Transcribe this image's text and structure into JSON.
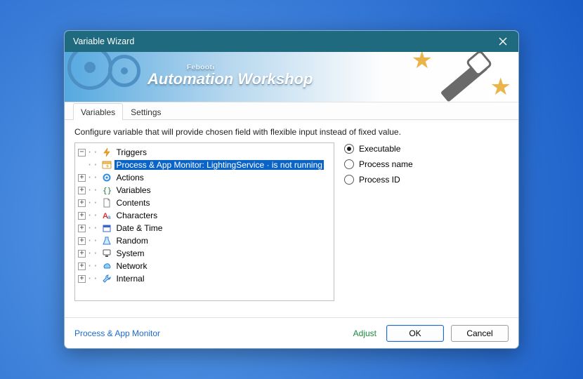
{
  "window": {
    "title": "Variable Wizard"
  },
  "banner": {
    "brand_small": "Febooti",
    "brand": "Automation Workshop"
  },
  "tabs": {
    "variables": "Variables",
    "settings": "Settings",
    "active": "variables"
  },
  "instruction": "Configure variable that will provide chosen field with flexible input instead of fixed value.",
  "tree": {
    "triggers": {
      "label": "Triggers",
      "expanded": true,
      "child_label": "Process & App Monitor: LightingService · is not running",
      "child_selected": true
    },
    "actions": {
      "label": "Actions"
    },
    "variables": {
      "label": "Variables"
    },
    "contents": {
      "label": "Contents"
    },
    "characters": {
      "label": "Characters"
    },
    "datetime": {
      "label": "Date & Time"
    },
    "random": {
      "label": "Random"
    },
    "system": {
      "label": "System"
    },
    "network": {
      "label": "Network"
    },
    "internal": {
      "label": "Internal"
    }
  },
  "radios": {
    "selected": "executable",
    "executable": "Executable",
    "process_name": "Process name",
    "process_id": "Process ID"
  },
  "footer": {
    "context": "Process & App Monitor",
    "adjust": "Adjust",
    "ok": "OK",
    "cancel": "Cancel"
  }
}
